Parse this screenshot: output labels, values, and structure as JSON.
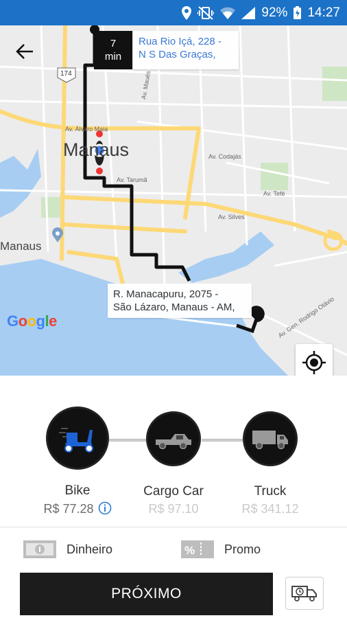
{
  "status_bar": {
    "battery_percent": "92%",
    "time": "14:27",
    "icons": [
      "location-icon",
      "vibrate-mute-icon",
      "wifi-icon",
      "signal-icon",
      "battery-charging-icon"
    ]
  },
  "map": {
    "eta_value": "7",
    "eta_unit": "min",
    "origin_line1": "Rua Rio Içá, 228 -",
    "origin_line2": "N S Das Graças,",
    "destination_line1": "R. Manacapuru, 2075 -",
    "destination_line2": "São Lázaro, Manaus - AM,",
    "city_label": "Manaus",
    "poi_label": "Manaus",
    "road_labels": {
      "a": "Av. Álvaro Maia",
      "b": "Av. Codajás",
      "c": "Av. Tarumã",
      "d": "Av. Tefé",
      "e": "Av. Silves",
      "f": "Av. Maués",
      "g": "Av. Gen. Rodrigo Otávio",
      "h": "174"
    },
    "google_logo": {
      "g1": "G",
      "o1": "o",
      "o2": "o",
      "g2": "g",
      "l": "l",
      "e": "e"
    },
    "route_color": "#111111",
    "water_color": "#a7cdf2",
    "highway_color": "#fdd876"
  },
  "vehicles": [
    {
      "name": "Bike",
      "price": "R$ 77.28",
      "selected": true,
      "icon": "scooter-icon"
    },
    {
      "name": "Cargo Car",
      "price": "R$ 97.10",
      "selected": false,
      "icon": "pickup-truck-icon"
    },
    {
      "name": "Truck",
      "price": "R$ 341.12",
      "selected": false,
      "icon": "box-truck-icon"
    }
  ],
  "payment": {
    "cash_label": "Dinheiro",
    "promo_label": "Promo"
  },
  "actions": {
    "next_label": "PRÓXIMO"
  },
  "colors": {
    "status_bar": "#1c72c7",
    "button_dark": "#1c1c1c",
    "bike_blue": "#1e63d6"
  }
}
